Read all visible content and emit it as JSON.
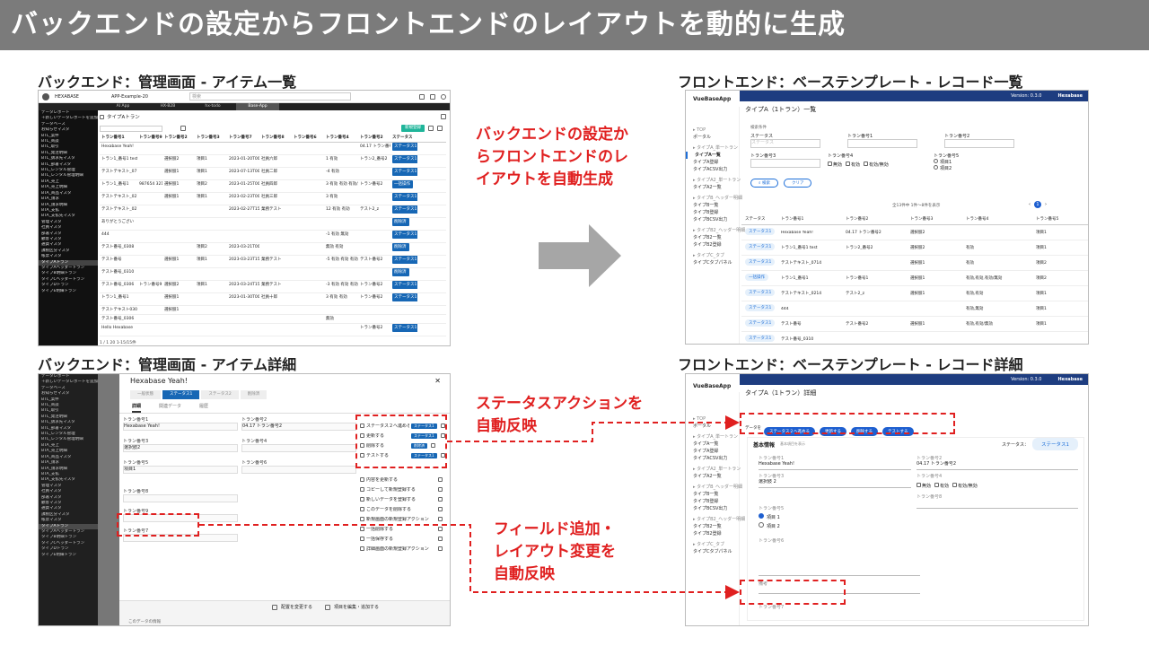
{
  "banner": {
    "title": "バックエンドの設定からフロントエンドのレイアウトを動的に生成"
  },
  "labels": {
    "be_list": "バックエンド：管理画面 - アイテム一覧",
    "be_detail": "バックエンド：管理画面 - アイテム詳細",
    "fe_list": "フロントエンド：ベーステンプレート - レコード一覧",
    "fe_detail": "フロントエンド：ベーステンプレート - レコード詳細"
  },
  "annotations": {
    "main_1": "バックエンドの設定か",
    "main_2": "らフロントエンドのレ",
    "main_3": "イアウトを自動生成",
    "status_1": "ステータスアクションを",
    "status_2": "自動反映",
    "field_1": "フィールド追加・",
    "field_2": "レイアウト変更を",
    "field_3": "自動反映"
  },
  "colors": {
    "banner_bg": "#7b7b7b",
    "accent_red": "#e02020",
    "fe_header": "#1e3d80",
    "be_button": "#1fb59a",
    "arrow": "#a6a6a6"
  },
  "be_list": {
    "logo": "HEXABASE",
    "workspace": "APP-Example-20",
    "search_placeholder": "検索",
    "tabs": [
      "AI App",
      "HX-B2B",
      "hx-todo",
      "Base-App"
    ],
    "page_title": "タイプAトラン",
    "new_button": "新規登録",
    "sidebar": [
      "データレポート",
      "＋新しいデータレポートを追加",
      "データベース",
      "お知らせマスタ",
      "BTL_案件",
      "BTL_商談",
      "BTL_取引",
      "BTL_発注明細",
      "BTL_請求先マスタ",
      "BTL_部署マスタ",
      "BTL_レンタル管理",
      "BTL_レンタル管理明細",
      "BTA_売上",
      "BTA_売上明細",
      "BTA_商品マスタ",
      "BTA_請求",
      "BTA_請求明細",
      "BTA_支払",
      "BTA_支払先マスタ",
      "管理マスタ",
      "社員マスタ",
      "部署マスタ",
      "顧客マスタ",
      "通貨マスタ",
      "課税区分マスタ",
      "帳票マスタ",
      "タイプAトラン",
      "タイプAヘッダートラン",
      "タイプB明細トラン",
      "タイプCヘッダートラン",
      "タイプDトラン",
      "タイプE明細トラン"
    ],
    "columns": [
      "トラン番号1",
      "トラン番号9",
      "トラン番号2",
      "トラン番号3",
      "トラン番号7",
      "トラン番号8",
      "トラン番号6",
      "トラン番号4",
      "トラン番号2",
      "ステータス"
    ],
    "rows": [
      [
        "Hexabase Yeah!",
        "",
        "",
        "",
        "",
        "",
        "",
        "",
        "04.17 トラン番号2",
        "ステータス1"
      ],
      [
        "トラン1_番号1 test",
        "",
        "選択肢2",
        "項目1",
        "2023-01-20T00:",
        "社員六郎",
        "",
        "1 有効",
        "トラン2_番号2",
        "ステータス1"
      ],
      [
        "テストテキスト_0714",
        "",
        "選択肢1",
        "項目1",
        "2023-07-13T00:",
        "社員二郎",
        "",
        "-4 有効",
        "",
        "ステータス1"
      ],
      [
        "トラン1_番号1",
        "987654 321 0",
        "選択肢1",
        "項目2",
        "2023-01-25T00:",
        "社員四郎",
        "",
        "3 有効 有効 有効/無",
        "トラン番号2",
        "一括操作"
      ],
      [
        "テストテキスト_0214 テスト+",
        "",
        "選択肢1",
        "項目1",
        "2023-02-23T00:",
        "社員三郎",
        "",
        "3 有効",
        "",
        "ステータス1"
      ],
      [
        "テストテキスト_0214 テスト+",
        "",
        "",
        "",
        "2023-02-27T15:",
        "業務テスト",
        "",
        "12 有効 有効",
        "テスト2_z",
        "ステータス1"
      ],
      [
        "ありがとうござい",
        "",
        "",
        "",
        "",
        "",
        "",
        "",
        "",
        "削除済"
      ],
      [
        "444",
        "",
        "",
        "",
        "",
        "",
        "",
        "-1 有効 無効",
        "",
        "ステータス1"
      ],
      [
        "テスト番号_0308",
        "",
        "",
        "項目2",
        "2023-03-21T00:",
        "",
        "",
        "無効 有効",
        "",
        "削除済"
      ],
      [
        "テスト番号",
        "",
        "選択肢1",
        "項目1",
        "2023-03-23T15:",
        "業務テスト",
        "",
        "-5 有効 有効 有効",
        "テスト番号2",
        "ステータス1"
      ],
      [
        "テスト番号_0310",
        "",
        "",
        "",
        "",
        "",
        "",
        "",
        "",
        "削除済"
      ],
      [
        "テスト番号_0306",
        "トラン番号9",
        "選択肢2",
        "項目1",
        "2023-03-24T15:",
        "業務テスト",
        "",
        "-3 有効 有効 有効",
        "トラン番号2",
        "ステータス1"
      ],
      [
        "トラン1_番号1",
        "",
        "選択肢1",
        "",
        "2023-01-30T00:",
        "社員十郎",
        "",
        "3 有効 有効",
        "トラン番号2",
        "ステータス1"
      ],
      [
        "テストテキスト0309",
        "",
        "選択肢1",
        "",
        "",
        "",
        "",
        "",
        "",
        ""
      ],
      [
        "テスト番号_0306",
        "",
        "",
        "",
        "",
        "",
        "",
        "無効",
        "",
        ""
      ],
      [
        "Hello Hexabase",
        "",
        "",
        "",
        "",
        "",
        "",
        "",
        "トラン番号2",
        "ステータス1"
      ]
    ],
    "pagination": "1 / 1  20 1-15/15件"
  },
  "be_detail": {
    "title": "Hexabase Yeah!",
    "steps": [
      "一般状態",
      "ステータス1",
      "ステータス2",
      "削除済"
    ],
    "tabs": [
      "詳細",
      "関連データ",
      "履歴"
    ],
    "fields": [
      {
        "label": "トラン番号1",
        "value": "Hexabase Yeah!"
      },
      {
        "label": "トラン番号2",
        "value": "04.17 トラン番号2"
      },
      {
        "label": "トラン番号3",
        "value": "選択肢2"
      },
      {
        "label": "トラン番号4",
        "value": ""
      },
      {
        "label": "トラン番号5",
        "value": "項目1"
      },
      {
        "label": "トラン番号6",
        "value": ""
      },
      {
        "label": "トラン番号8",
        "value": ""
      },
      {
        "label": "トラン番号9",
        "value": ""
      },
      {
        "label": "トラン番号7",
        "value": ""
      }
    ],
    "actions": [
      "ステータス２へ進める",
      "更新する",
      "削除する",
      "テストする"
    ],
    "action_status": [
      "ステータス1",
      "ステータス1",
      "削除済",
      "ステータス1"
    ],
    "extra_actions": [
      "内容を更新する",
      "コピーして新規登録する",
      "新しいデータを登録する",
      "このデータを削除する",
      "新規画面の新規登録アクション",
      "一括削除する",
      "一括保存する",
      "詳細画面の新規登録アクション"
    ],
    "footer_left": "配置を変更する",
    "footer_right": "項目を編集・追加する",
    "footer_note": "このデータの情報"
  },
  "fe_list": {
    "app_name": "VueBaseApp",
    "version": "Version: 0.3.0",
    "user": "Hexabase",
    "page_title": "タイプA（1トラン）一覧",
    "side": [
      {
        "t": "TOP",
        "g": true
      },
      {
        "t": "ポータル",
        "g": false
      },
      {
        "t": "タイプA_単一トラン",
        "g": true
      },
      {
        "t": "タイプA一覧",
        "g": false,
        "sel": true
      },
      {
        "t": "タイプA登録",
        "g": false
      },
      {
        "t": "タイプACSV出力",
        "g": false
      },
      {
        "t": "タイプA2_単一トラン",
        "g": true
      },
      {
        "t": "タイプA2一覧",
        "g": false
      },
      {
        "t": "タイプB_ヘッダー明細",
        "g": true
      },
      {
        "t": "タイプB一覧",
        "g": false
      },
      {
        "t": "タイプB登録",
        "g": false
      },
      {
        "t": "タイプBCSV出力",
        "g": false
      },
      {
        "t": "タイプB2_ヘッダー明細",
        "g": true
      },
      {
        "t": "タイプB2一覧",
        "g": false
      },
      {
        "t": "タイプB2登録",
        "g": false
      },
      {
        "t": "タイプC_タブ",
        "g": true
      },
      {
        "t": "タイプCタブパネル",
        "g": false
      }
    ],
    "filter_title": "検索条件",
    "filter_fields": [
      "ステータス",
      "トラン番号1",
      "トラン番号2",
      "トラン番号3",
      "トラン番号4",
      "トラン番号5"
    ],
    "status_placeholder": "ステータス",
    "checks": [
      "無効",
      "有効",
      "有効/無効"
    ],
    "radios": [
      "項目1",
      "項目2"
    ],
    "search_btn": "検索",
    "clear_btn": "クリア",
    "count": "全13件中 1件〜8件を表示",
    "page": "1",
    "columns": [
      "ステータス",
      "トラン番号1",
      "トラン番号2",
      "トラン番号3",
      "トラン番号4",
      "トラン番号5"
    ],
    "rows": [
      [
        "ステータス1",
        "Hexabase Yeah!",
        "04.17 トラン番号2",
        "選択肢2",
        "",
        "項目1"
      ],
      [
        "ステータス1",
        "トラン1_番号1 test",
        "トラン2_番号2",
        "選択肢2",
        "有効",
        "項目1"
      ],
      [
        "ステータス1",
        "テストテキスト_0714",
        "",
        "選択肢1",
        "有効",
        "項目2"
      ],
      [
        "一括操作",
        "トラン1_番号1",
        "トラン番号1",
        "選択肢1",
        "有効,有効,有効/無効",
        "項目2"
      ],
      [
        "ステータス1",
        "テストテキスト_0214",
        "テスト2_z",
        "選択肢1",
        "有効,有効",
        "項目1"
      ],
      [
        "ステータス1",
        "444",
        "",
        "",
        "有効,無効",
        "項目1"
      ],
      [
        "ステータス1",
        "テスト番号",
        "テスト番号2",
        "選択肢1",
        "有効,有効/無効",
        "項目1"
      ],
      [
        "ステータス1",
        "テスト番号_0310",
        "",
        "",
        "",
        ""
      ]
    ]
  },
  "fe_detail": {
    "page_title": "タイプA（1トラン）詳細",
    "actions": [
      "ステータス２へ進める",
      "更新する",
      "削除する",
      "テストする"
    ],
    "action_prefix": "データを",
    "section_title": "基本情報",
    "status_label": "ステータス：",
    "status_value": "ステータス1",
    "edit_hint": "基本項目を表示",
    "f1_label": "トラン番号1",
    "f1_value": "Hexabase Yeah!",
    "f2_label": "トラン番号2",
    "f2_value": "04.17 トラン番号2",
    "f3_label": "トラン番号3",
    "f3_value": "選択肢 2",
    "f4_label": "トラン番号4",
    "f5_label": "トラン番号5",
    "f6_label": "トラン番号6",
    "f7_label": "トラン番号7",
    "f8_label": "トラン番号8",
    "memo_label": "備考",
    "radios": [
      "項目 1",
      "項目 2"
    ],
    "checks": [
      "無効",
      "有効",
      "有効/無効"
    ]
  }
}
